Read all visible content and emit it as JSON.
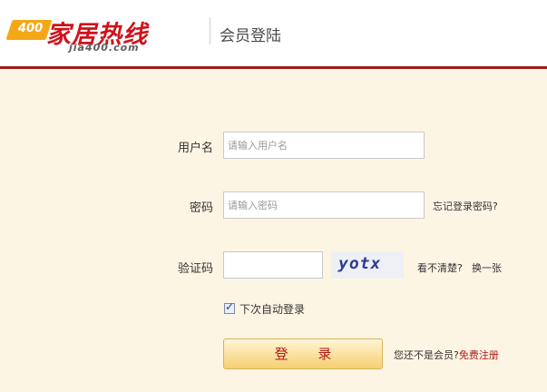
{
  "header": {
    "logo_badge": "400",
    "logo_title": "家居热线",
    "logo_domain": "jia400.com",
    "page_title": "会员登陆"
  },
  "form": {
    "username_label": "用户名",
    "username_placeholder": "请输入用户名",
    "password_label": "密码",
    "password_placeholder": "请输入密码",
    "forgot_password": "忘记登录密码?",
    "captcha_label": "验证码",
    "captcha_value": "",
    "captcha_image_text": "yotx",
    "refresh_captcha_prompt": "看不清楚?",
    "refresh_captcha_link": "换一张",
    "remember_me": "下次自动登录",
    "remember_checked": true,
    "login_button": "登 录",
    "not_member_prompt": "您还不是会员?",
    "register_link": "免费注册"
  },
  "colors": {
    "brand_red": "#d0121b",
    "header_rule": "#a31a1a",
    "panel_bg": "#fdf5e4",
    "button_text": "#b01818"
  }
}
